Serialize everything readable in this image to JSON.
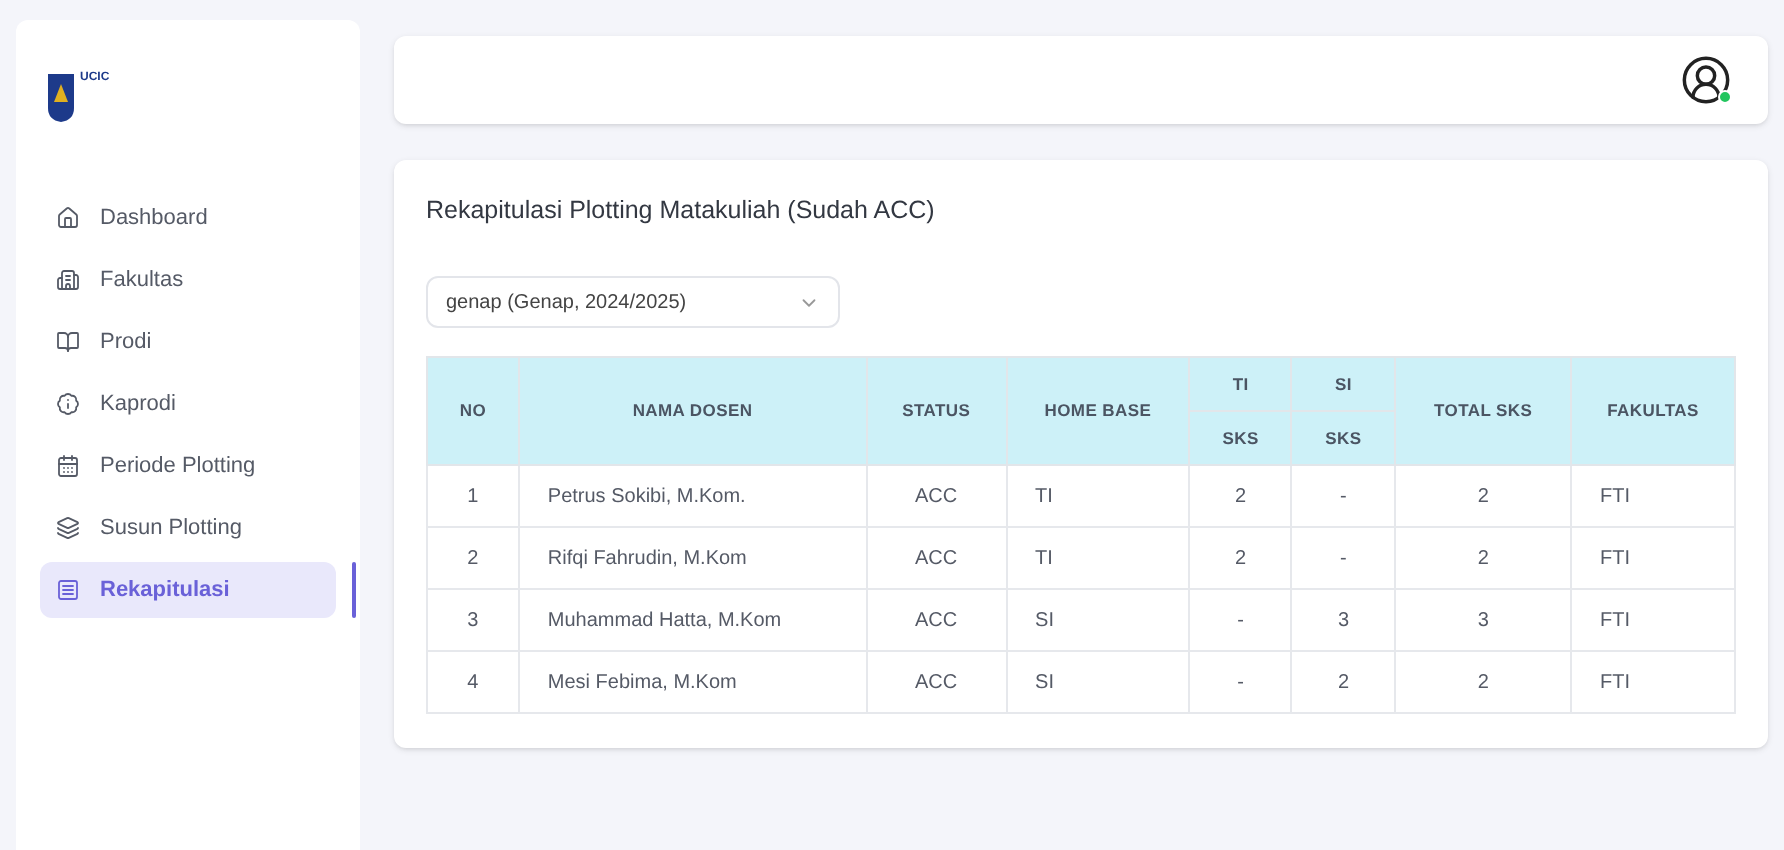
{
  "sidebar": {
    "logo_text": "UCIC",
    "items": [
      {
        "label": "Dashboard",
        "selected": false
      },
      {
        "label": "Fakultas",
        "selected": false
      },
      {
        "label": "Prodi",
        "selected": false
      },
      {
        "label": "Kaprodi",
        "selected": false
      },
      {
        "label": "Periode Plotting",
        "selected": false
      },
      {
        "label": "Susun Plotting",
        "selected": false
      },
      {
        "label": "Rekapitulasi",
        "selected": true
      }
    ]
  },
  "header": {
    "user_online": true
  },
  "main": {
    "title": "Rekapitulasi Plotting Matakuliah (Sudah ACC)",
    "period_select": {
      "value": "genap (Genap, 2024/2025)"
    },
    "table": {
      "columns": [
        "NO",
        "NAMA DOSEN",
        "STATUS",
        "HOME BASE",
        "TI",
        "SI",
        "TOTAL SKS",
        "FAKULTAS"
      ],
      "subcolumns": [
        "SKS",
        "SKS"
      ],
      "rows": [
        [
          "1",
          "Petrus Sokibi, M.Kom.",
          "ACC",
          "TI",
          "2",
          "-",
          "2",
          "FTI"
        ],
        [
          "2",
          "Rifqi Fahrudin, M.Kom",
          "ACC",
          "TI",
          "2",
          "-",
          "2",
          "FTI"
        ],
        [
          "3",
          "Muhammad Hatta, M.Kom",
          "ACC",
          "SI",
          "-",
          "3",
          "3",
          "FTI"
        ],
        [
          "4",
          "Mesi Febima, M.Kom",
          "ACC",
          "SI",
          "-",
          "2",
          "2",
          "FTI"
        ]
      ]
    }
  }
}
